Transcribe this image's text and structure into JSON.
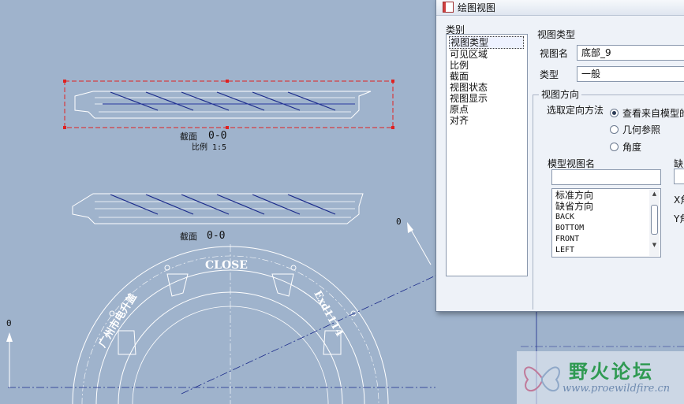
{
  "drawing": {
    "section_label_1": "截面",
    "section_name_1": "0-0",
    "scale_label": "比例 1:5",
    "section_label_2": "截面",
    "section_name_2": "0-0",
    "close_text": "CLOSE",
    "left_ring_text": "广州市电升盖",
    "right_ring_text": "Exd11T4",
    "axis_marker_right": "0",
    "axis_marker_left": "0",
    "colors": {
      "background": "#9fb3cc",
      "geometry": "#ffffff",
      "hatch": "#1a2a8a",
      "selection": "#e02020"
    }
  },
  "dialog": {
    "title": "绘图视图",
    "category_label": "类别",
    "categories": [
      "视图类型",
      "可见区域",
      "比例",
      "截面",
      "视图状态",
      "视图显示",
      "原点",
      "对齐"
    ],
    "selected_category": "视图类型",
    "section_title": "视图类型",
    "view_name_label": "视图名",
    "view_name_value": "底部_9",
    "type_label": "类型",
    "type_value": "一般",
    "orientation_group": "视图方向",
    "orientation_method_label": "选取定向方法",
    "orientation_options": [
      "查看来自模型的名称",
      "几何参照",
      "角度"
    ],
    "model_view_name_label": "模型视图名",
    "model_view_search": "",
    "model_views": [
      "标准方向",
      "缺省方向",
      "BACK",
      "BOTTOM",
      "FRONT",
      "LEFT"
    ],
    "cut_label_1": "缺",
    "cut_label_2": "X角",
    "cut_label_3": "Y角"
  },
  "watermark": {
    "title": "野火论坛",
    "url": "www.proewildfire.cn"
  }
}
